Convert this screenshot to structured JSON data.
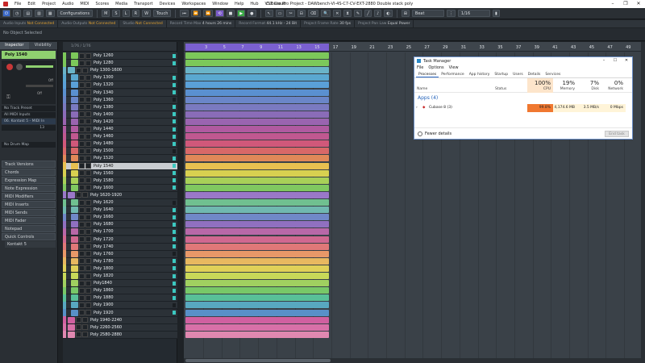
{
  "window": {
    "title": "Cubase Pro Project - DAWbench-VI-4S-C7-CV-EXT-2880 Double stack poly",
    "menu": [
      "File",
      "Edit",
      "Project",
      "Audio",
      "MIDI",
      "Scores",
      "Media",
      "Transport",
      "Devices",
      "Workspaces",
      "Window",
      "Help",
      "Hub",
      "VST Cloud"
    ],
    "controls": [
      "–",
      "❐",
      "✕"
    ]
  },
  "toolbar": {
    "configurations": "Configurations",
    "touch": "Touch",
    "beat": "Beat",
    "quantize": "1/16"
  },
  "status": {
    "audio_inputs": "Audio Inputs",
    "ai_val": "Not Connected",
    "audio_outputs": "Audio Outputs",
    "ao_val": "Not Connected",
    "studio": "Studio",
    "studio_val": "Not Connected",
    "record_time_max": "Record Time Max",
    "rtm_val": "4 hours 26 mins",
    "record_format": "Record Format",
    "rf_val": "44.1 kHz - 24 Bit",
    "frame_rate": "Project Frame Rate",
    "fr_val": "30 fps",
    "pan_law": "Project Pan Law",
    "pl_val": "Equal Power"
  },
  "info": {
    "no_object": "No Object Selected"
  },
  "inspector": {
    "tab_inspector": "Inspector",
    "tab_visibility": "Visibility",
    "track_name": "Poly 1540",
    "fields": [
      "No Track Preset",
      "All MIDI Inputs",
      "06. Kontakt 5 - MIDI In",
      "No Drum Map"
    ],
    "channel": "13",
    "off_label": "Off",
    "sections": [
      "Track Versions",
      "Chords",
      "Expression Map",
      "Note Expression",
      "MIDI Modifiers",
      "MIDI Inserts",
      "MIDI Sends",
      "MIDI Fader",
      "Notepad",
      "Quick Controls"
    ],
    "instrument": "Kontakt 5"
  },
  "tracklist": {
    "header": "1/76 / 1/76",
    "tracks": [
      {
        "name": "Poly 1260",
        "color": "#7cc85a",
        "folder": false
      },
      {
        "name": "Poly 1280",
        "color": "#7cc85a",
        "folder": false
      },
      {
        "name": "Poly 1300-1600",
        "color": "#6ab4c8",
        "folder": true
      },
      {
        "name": "Poly 1300",
        "color": "#5aa8d0",
        "folder": false
      },
      {
        "name": "Poly 1320",
        "color": "#5aa0d8",
        "folder": false
      },
      {
        "name": "Poly 1340",
        "color": "#5a90d0",
        "folder": false
      },
      {
        "name": "Poly 1360",
        "color": "#6a86c8",
        "folder": false
      },
      {
        "name": "Poly 1380",
        "color": "#7a7ac0",
        "folder": false
      },
      {
        "name": "Poly 1400",
        "color": "#8a6cb8",
        "folder": false
      },
      {
        "name": "Poly 1420",
        "color": "#9a64b0",
        "folder": false
      },
      {
        "name": "Poly 1440",
        "color": "#b05aa0",
        "folder": false
      },
      {
        "name": "Poly 1460",
        "color": "#c05890",
        "folder": false
      },
      {
        "name": "Poly 1480",
        "color": "#d0587a",
        "folder": false
      },
      {
        "name": "Poly 1500",
        "color": "#d86868",
        "folder": false
      },
      {
        "name": "Poly 1520",
        "color": "#e08858",
        "folder": false
      },
      {
        "name": "Poly 1540",
        "color": "#e8c050",
        "folder": false
      },
      {
        "name": "Poly 1560",
        "color": "#d8d050",
        "folder": false
      },
      {
        "name": "Poly 1580",
        "color": "#a8d058",
        "folder": false
      },
      {
        "name": "Poly 1600",
        "color": "#80c860",
        "folder": false
      },
      {
        "name": "Poly 1620-1920",
        "color": "#9a78c8",
        "folder": true
      },
      {
        "name": "Poly 1620",
        "color": "#70c090",
        "folder": false
      },
      {
        "name": "Poly 1640",
        "color": "#70b8b0",
        "folder": false
      },
      {
        "name": "Poly 1660",
        "color": "#7088c8",
        "folder": false
      },
      {
        "name": "Poly 1680",
        "color": "#9070c0",
        "folder": false
      },
      {
        "name": "Poly 1700",
        "color": "#b868a8",
        "folder": false
      },
      {
        "name": "Poly 1720",
        "color": "#d06890",
        "folder": false
      },
      {
        "name": "Poly 1740",
        "color": "#e07878",
        "folder": false
      },
      {
        "name": "Poly 1760",
        "color": "#e89868",
        "folder": false
      },
      {
        "name": "Poly 1780",
        "color": "#e8b860",
        "folder": false
      },
      {
        "name": "Poly 1800",
        "color": "#e0d058",
        "folder": false
      },
      {
        "name": "Poly 1820",
        "color": "#c8d858",
        "folder": false
      },
      {
        "name": "Poly1840",
        "color": "#a0d060",
        "folder": false
      },
      {
        "name": "Poly 1860",
        "color": "#78c868",
        "folder": false
      },
      {
        "name": "Poly 1880",
        "color": "#58c098",
        "folder": false
      },
      {
        "name": "Poly 1900",
        "color": "#58a8c0",
        "folder": false
      },
      {
        "name": "Poly 1920",
        "color": "#5890c8",
        "folder": false
      },
      {
        "name": "Poly 1940-2240",
        "color": "#d060a0",
        "folder": true
      },
      {
        "name": "Poly 2260-2560",
        "color": "#d870a8",
        "folder": true
      },
      {
        "name": "Poly 2580-2880",
        "color": "#e088b0",
        "folder": true
      }
    ],
    "selected": "Poly 1540"
  },
  "ruler": {
    "bars": [
      "3",
      "5",
      "7",
      "9",
      "11",
      "13",
      "15",
      "17",
      "19",
      "21",
      "23",
      "25",
      "27",
      "29",
      "31",
      "33",
      "35",
      "37",
      "39",
      "41",
      "43",
      "45",
      "47",
      "49"
    ]
  },
  "task_manager": {
    "title": "Task Manager",
    "menu": [
      "File",
      "Options",
      "View"
    ],
    "tabs": [
      "Processes",
      "Performance",
      "App history",
      "Startup",
      "Users",
      "Details",
      "Services"
    ],
    "col_name": "Name",
    "col_status": "Status",
    "cpu_pct": "100%",
    "cpu_label": "CPU",
    "mem_pct": "19%",
    "mem_label": "Memory",
    "disk_pct": "7%",
    "disk_label": "Disk",
    "net_pct": "0%",
    "net_label": "Network",
    "group": "Apps (4)",
    "process": {
      "name": "Cubase 8 (3)",
      "cpu": "99.8%",
      "mem": "4,174.6 MB",
      "disk": "3.5 MB/s",
      "net": "0 Mbps"
    },
    "fewer_details": "Fewer details",
    "end_task": "End task"
  }
}
